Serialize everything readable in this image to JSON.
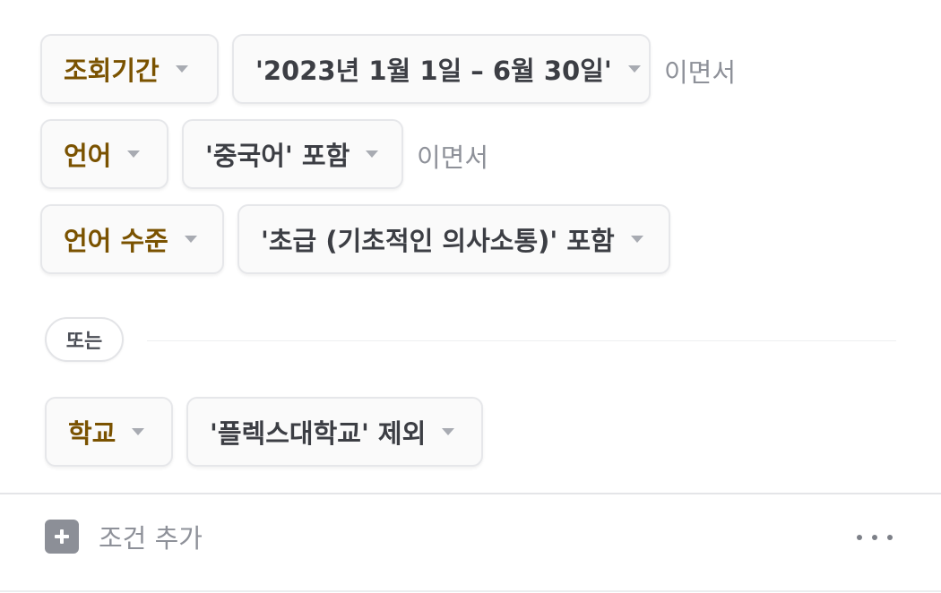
{
  "filters": {
    "row1": {
      "field": "조회기간",
      "value": "'2023년 1월 1일 – 6월 30일'",
      "conjunction": "이면서"
    },
    "row2": {
      "field": "언어",
      "value": "'중국어' 포함",
      "conjunction": "이면서"
    },
    "row3": {
      "field": "언어 수준",
      "value": "'초급 (기초적인 의사소통)' 포함"
    }
  },
  "or_separator": "또는",
  "group2": {
    "row1": {
      "field": "학교",
      "value": "'플렉스대학교' 제외"
    }
  },
  "footer": {
    "add_condition_label": "조건 추가",
    "add_icon": "plus-square-icon",
    "more_icon": "more-horizontal-icon"
  },
  "colors": {
    "field_text": "#7a5200",
    "value_text": "#3c3e44",
    "muted_text": "#8e9199"
  }
}
